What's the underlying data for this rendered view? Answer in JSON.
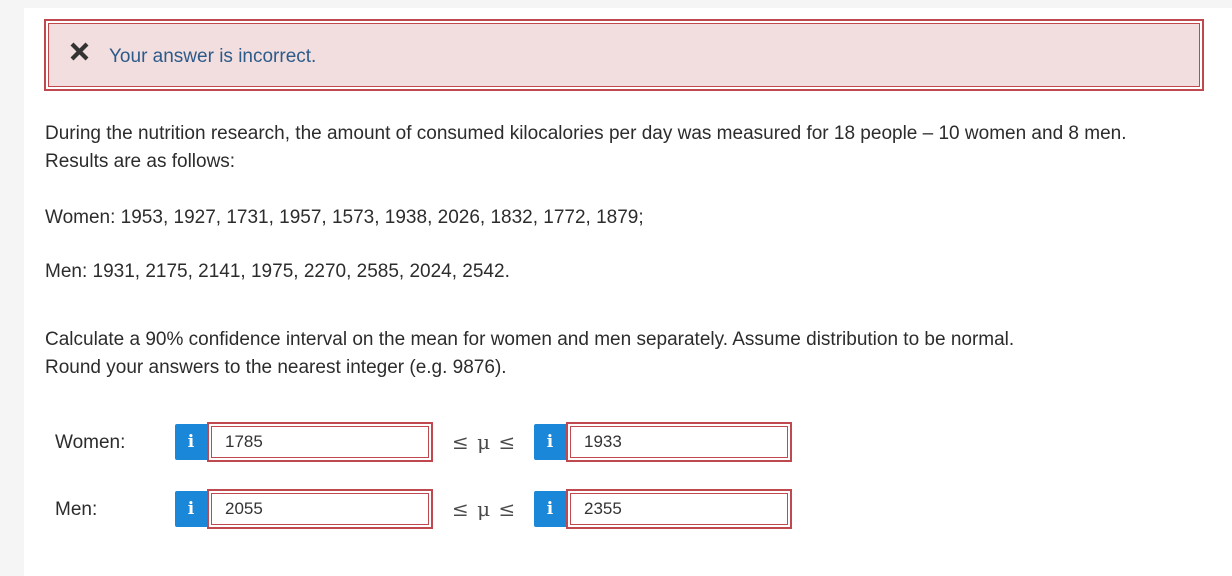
{
  "alert": {
    "icon": "close-icon",
    "icon_color": "#333333",
    "message": "Your answer is incorrect.",
    "background": "#f2dede",
    "border_color": "#c0494f"
  },
  "problem": {
    "intro_line1": "During the nutrition research, the amount of consumed kilocalories per day was measured for 18 people – 10 women and 8 men.",
    "intro_line2": "Results are as follows:",
    "women_data": "Women: 1953, 1927, 1731, 1957, 1573, 1938, 2026, 1832, 1772, 1879;",
    "men_data": "Men: 1931, 2175, 2141, 1975, 2270, 2585, 2024, 2542.",
    "task_line1": "Calculate a 90% confidence interval on the mean for women and men separately. Assume distribution to be normal.",
    "task_line2": "Round your answers to the nearest integer (e.g. 9876)."
  },
  "answers": {
    "info_icon_label": "i",
    "mu_symbol": "≤ μ ≤",
    "women": {
      "label": "Women:",
      "lower": "1785",
      "upper": "1933"
    },
    "men": {
      "label": "Men:",
      "lower": "2055",
      "upper": "2355"
    }
  }
}
